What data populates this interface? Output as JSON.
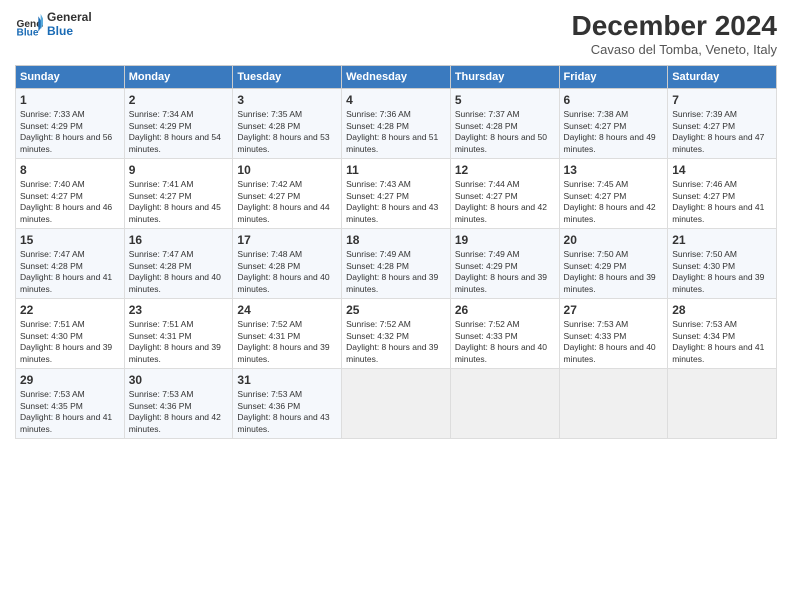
{
  "logo": {
    "line1": "General",
    "line2": "Blue"
  },
  "title": "December 2024",
  "subtitle": "Cavaso del Tomba, Veneto, Italy",
  "days_header": [
    "Sunday",
    "Monday",
    "Tuesday",
    "Wednesday",
    "Thursday",
    "Friday",
    "Saturday"
  ],
  "weeks": [
    [
      {
        "day": "1",
        "sunrise": "Sunrise: 7:33 AM",
        "sunset": "Sunset: 4:29 PM",
        "daylight": "Daylight: 8 hours and 56 minutes."
      },
      {
        "day": "2",
        "sunrise": "Sunrise: 7:34 AM",
        "sunset": "Sunset: 4:29 PM",
        "daylight": "Daylight: 8 hours and 54 minutes."
      },
      {
        "day": "3",
        "sunrise": "Sunrise: 7:35 AM",
        "sunset": "Sunset: 4:28 PM",
        "daylight": "Daylight: 8 hours and 53 minutes."
      },
      {
        "day": "4",
        "sunrise": "Sunrise: 7:36 AM",
        "sunset": "Sunset: 4:28 PM",
        "daylight": "Daylight: 8 hours and 51 minutes."
      },
      {
        "day": "5",
        "sunrise": "Sunrise: 7:37 AM",
        "sunset": "Sunset: 4:28 PM",
        "daylight": "Daylight: 8 hours and 50 minutes."
      },
      {
        "day": "6",
        "sunrise": "Sunrise: 7:38 AM",
        "sunset": "Sunset: 4:27 PM",
        "daylight": "Daylight: 8 hours and 49 minutes."
      },
      {
        "day": "7",
        "sunrise": "Sunrise: 7:39 AM",
        "sunset": "Sunset: 4:27 PM",
        "daylight": "Daylight: 8 hours and 47 minutes."
      }
    ],
    [
      {
        "day": "8",
        "sunrise": "Sunrise: 7:40 AM",
        "sunset": "Sunset: 4:27 PM",
        "daylight": "Daylight: 8 hours and 46 minutes."
      },
      {
        "day": "9",
        "sunrise": "Sunrise: 7:41 AM",
        "sunset": "Sunset: 4:27 PM",
        "daylight": "Daylight: 8 hours and 45 minutes."
      },
      {
        "day": "10",
        "sunrise": "Sunrise: 7:42 AM",
        "sunset": "Sunset: 4:27 PM",
        "daylight": "Daylight: 8 hours and 44 minutes."
      },
      {
        "day": "11",
        "sunrise": "Sunrise: 7:43 AM",
        "sunset": "Sunset: 4:27 PM",
        "daylight": "Daylight: 8 hours and 43 minutes."
      },
      {
        "day": "12",
        "sunrise": "Sunrise: 7:44 AM",
        "sunset": "Sunset: 4:27 PM",
        "daylight": "Daylight: 8 hours and 42 minutes."
      },
      {
        "day": "13",
        "sunrise": "Sunrise: 7:45 AM",
        "sunset": "Sunset: 4:27 PM",
        "daylight": "Daylight: 8 hours and 42 minutes."
      },
      {
        "day": "14",
        "sunrise": "Sunrise: 7:46 AM",
        "sunset": "Sunset: 4:27 PM",
        "daylight": "Daylight: 8 hours and 41 minutes."
      }
    ],
    [
      {
        "day": "15",
        "sunrise": "Sunrise: 7:47 AM",
        "sunset": "Sunset: 4:28 PM",
        "daylight": "Daylight: 8 hours and 41 minutes."
      },
      {
        "day": "16",
        "sunrise": "Sunrise: 7:47 AM",
        "sunset": "Sunset: 4:28 PM",
        "daylight": "Daylight: 8 hours and 40 minutes."
      },
      {
        "day": "17",
        "sunrise": "Sunrise: 7:48 AM",
        "sunset": "Sunset: 4:28 PM",
        "daylight": "Daylight: 8 hours and 40 minutes."
      },
      {
        "day": "18",
        "sunrise": "Sunrise: 7:49 AM",
        "sunset": "Sunset: 4:28 PM",
        "daylight": "Daylight: 8 hours and 39 minutes."
      },
      {
        "day": "19",
        "sunrise": "Sunrise: 7:49 AM",
        "sunset": "Sunset: 4:29 PM",
        "daylight": "Daylight: 8 hours and 39 minutes."
      },
      {
        "day": "20",
        "sunrise": "Sunrise: 7:50 AM",
        "sunset": "Sunset: 4:29 PM",
        "daylight": "Daylight: 8 hours and 39 minutes."
      },
      {
        "day": "21",
        "sunrise": "Sunrise: 7:50 AM",
        "sunset": "Sunset: 4:30 PM",
        "daylight": "Daylight: 8 hours and 39 minutes."
      }
    ],
    [
      {
        "day": "22",
        "sunrise": "Sunrise: 7:51 AM",
        "sunset": "Sunset: 4:30 PM",
        "daylight": "Daylight: 8 hours and 39 minutes."
      },
      {
        "day": "23",
        "sunrise": "Sunrise: 7:51 AM",
        "sunset": "Sunset: 4:31 PM",
        "daylight": "Daylight: 8 hours and 39 minutes."
      },
      {
        "day": "24",
        "sunrise": "Sunrise: 7:52 AM",
        "sunset": "Sunset: 4:31 PM",
        "daylight": "Daylight: 8 hours and 39 minutes."
      },
      {
        "day": "25",
        "sunrise": "Sunrise: 7:52 AM",
        "sunset": "Sunset: 4:32 PM",
        "daylight": "Daylight: 8 hours and 39 minutes."
      },
      {
        "day": "26",
        "sunrise": "Sunrise: 7:52 AM",
        "sunset": "Sunset: 4:33 PM",
        "daylight": "Daylight: 8 hours and 40 minutes."
      },
      {
        "day": "27",
        "sunrise": "Sunrise: 7:53 AM",
        "sunset": "Sunset: 4:33 PM",
        "daylight": "Daylight: 8 hours and 40 minutes."
      },
      {
        "day": "28",
        "sunrise": "Sunrise: 7:53 AM",
        "sunset": "Sunset: 4:34 PM",
        "daylight": "Daylight: 8 hours and 41 minutes."
      }
    ],
    [
      {
        "day": "29",
        "sunrise": "Sunrise: 7:53 AM",
        "sunset": "Sunset: 4:35 PM",
        "daylight": "Daylight: 8 hours and 41 minutes."
      },
      {
        "day": "30",
        "sunrise": "Sunrise: 7:53 AM",
        "sunset": "Sunset: 4:36 PM",
        "daylight": "Daylight: 8 hours and 42 minutes."
      },
      {
        "day": "31",
        "sunrise": "Sunrise: 7:53 AM",
        "sunset": "Sunset: 4:36 PM",
        "daylight": "Daylight: 8 hours and 43 minutes."
      },
      null,
      null,
      null,
      null
    ]
  ]
}
